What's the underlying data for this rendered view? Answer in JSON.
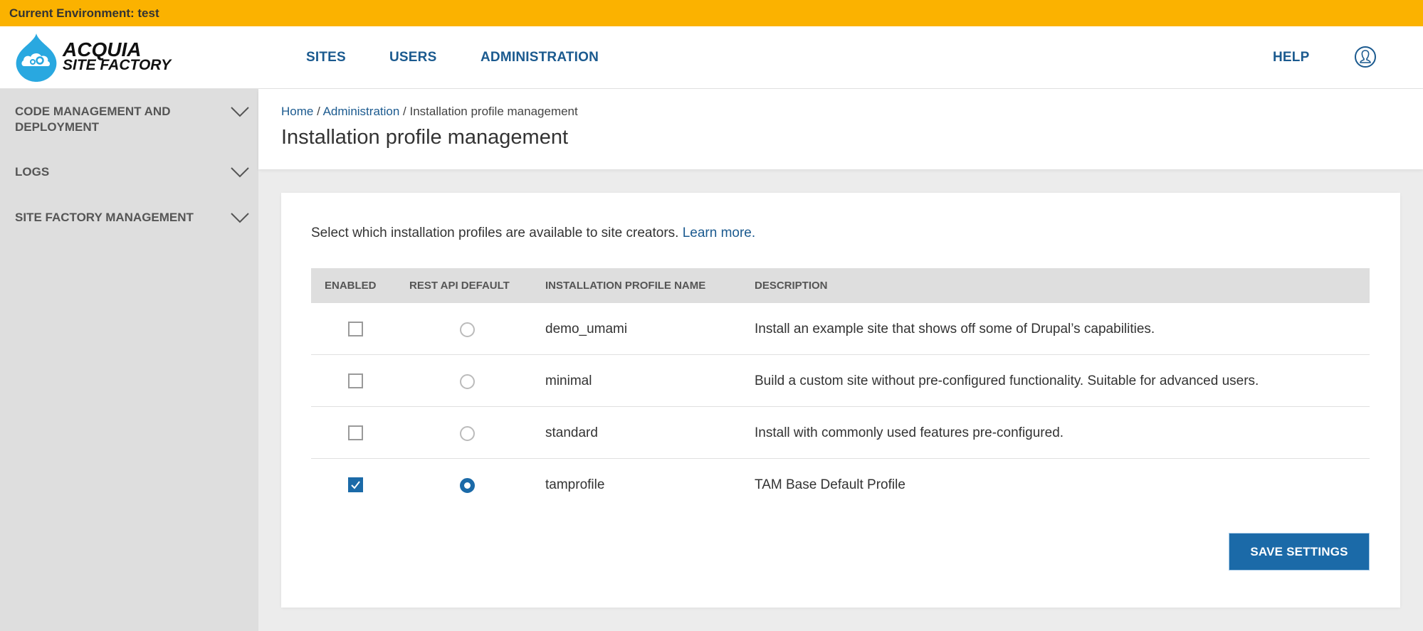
{
  "environment": {
    "label": "Current Environment: test",
    "color": "#fbb200"
  },
  "header": {
    "logo": {
      "line1": "ACQUIA",
      "line2": "SITE FACTORY",
      "color": "#29a8e0"
    },
    "nav": [
      {
        "label": "SITES"
      },
      {
        "label": "USERS"
      },
      {
        "label": "ADMINISTRATION"
      }
    ],
    "help_label": "HELP",
    "user_icon": "user-circle-icon",
    "link_color": "#1b5a8f"
  },
  "sidebar": {
    "items": [
      {
        "label": "CODE MANAGEMENT AND DEPLOYMENT",
        "icon": "chevron-down-icon"
      },
      {
        "label": "LOGS",
        "icon": "chevron-down-icon"
      },
      {
        "label": "SITE FACTORY MANAGEMENT",
        "icon": "chevron-down-icon"
      }
    ]
  },
  "breadcrumb": {
    "items": [
      {
        "label": "Home",
        "link": true
      },
      {
        "label": "Administration",
        "link": true
      },
      {
        "label": "Installation profile management",
        "link": false
      }
    ],
    "separator": " / "
  },
  "page_title": "Installation profile management",
  "intro": {
    "text": "Select which installation profiles are available to site creators. ",
    "link_label": "Learn more."
  },
  "table": {
    "columns": [
      "ENABLED",
      "REST API DEFAULT",
      "INSTALLATION PROFILE NAME",
      "DESCRIPTION"
    ],
    "rows": [
      {
        "enabled": false,
        "rest_default": false,
        "name": "demo_umami",
        "description": "Install an example site that shows off some of Drupal’s capabilities."
      },
      {
        "enabled": false,
        "rest_default": false,
        "name": "minimal",
        "description": "Build a custom site without pre-configured functionality. Suitable for advanced users."
      },
      {
        "enabled": false,
        "rest_default": false,
        "name": "standard",
        "description": "Install with commonly used features pre-configured."
      },
      {
        "enabled": true,
        "rest_default": true,
        "name": "tamprofile",
        "description": "TAM Base Default Profile"
      }
    ]
  },
  "save_button": {
    "label": "SAVE SETTINGS",
    "color": "#1b6aa8"
  }
}
